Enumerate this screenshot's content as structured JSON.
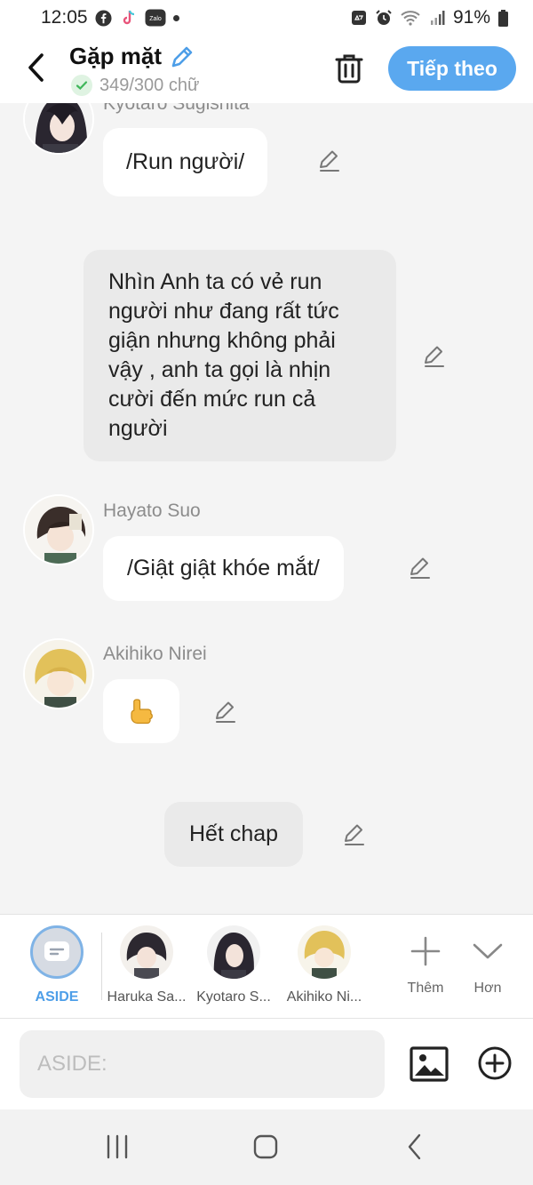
{
  "status_bar": {
    "time": "12:05",
    "battery": "91%",
    "left_icons": [
      "facebook-icon",
      "tiktok-icon",
      "zalo-icon",
      "notification-dot-icon"
    ],
    "right_icons": [
      "recycle-icon",
      "alarm-icon",
      "wifi-icon",
      "signal-icon",
      "battery-icon"
    ],
    "zalo_text": "Zalo"
  },
  "header": {
    "title": "Gặp mặt",
    "word_count": "349/300 chữ",
    "next_label": "Tiếp theo",
    "accent": "#5aa8ef"
  },
  "chat": {
    "cut_off_speaker": "Kyotaro Sugishita",
    "messages": [
      {
        "speaker": "",
        "text": "/Run người/",
        "type": "character"
      },
      {
        "speaker": "",
        "text": "Nhìn Anh ta có vẻ run người như đang rất tức giận nhưng không phải vậy , anh ta gọi là nhịn cười đến mức run cả người",
        "type": "narration"
      },
      {
        "speaker": "Hayato Suo",
        "text": "/Giật giật khóe mắt/",
        "type": "character"
      },
      {
        "speaker": "Akihiko Nirei",
        "text": "👆",
        "type": "character"
      },
      {
        "speaker": "",
        "text": "Hết chap",
        "type": "narration"
      }
    ]
  },
  "character_bar": {
    "items": [
      {
        "label": "ASIDE",
        "active": true
      },
      {
        "label": "Haruka Sa...",
        "active": false
      },
      {
        "label": "Kyotaro S...",
        "active": false
      },
      {
        "label": "Akihiko Ni...",
        "active": false
      }
    ],
    "add_label": "Thêm",
    "more_label": "Hơn"
  },
  "input": {
    "placeholder": "ASIDE:",
    "value": ""
  },
  "nav": {
    "icons": [
      "recent-apps-icon",
      "home-icon",
      "back-icon"
    ]
  }
}
